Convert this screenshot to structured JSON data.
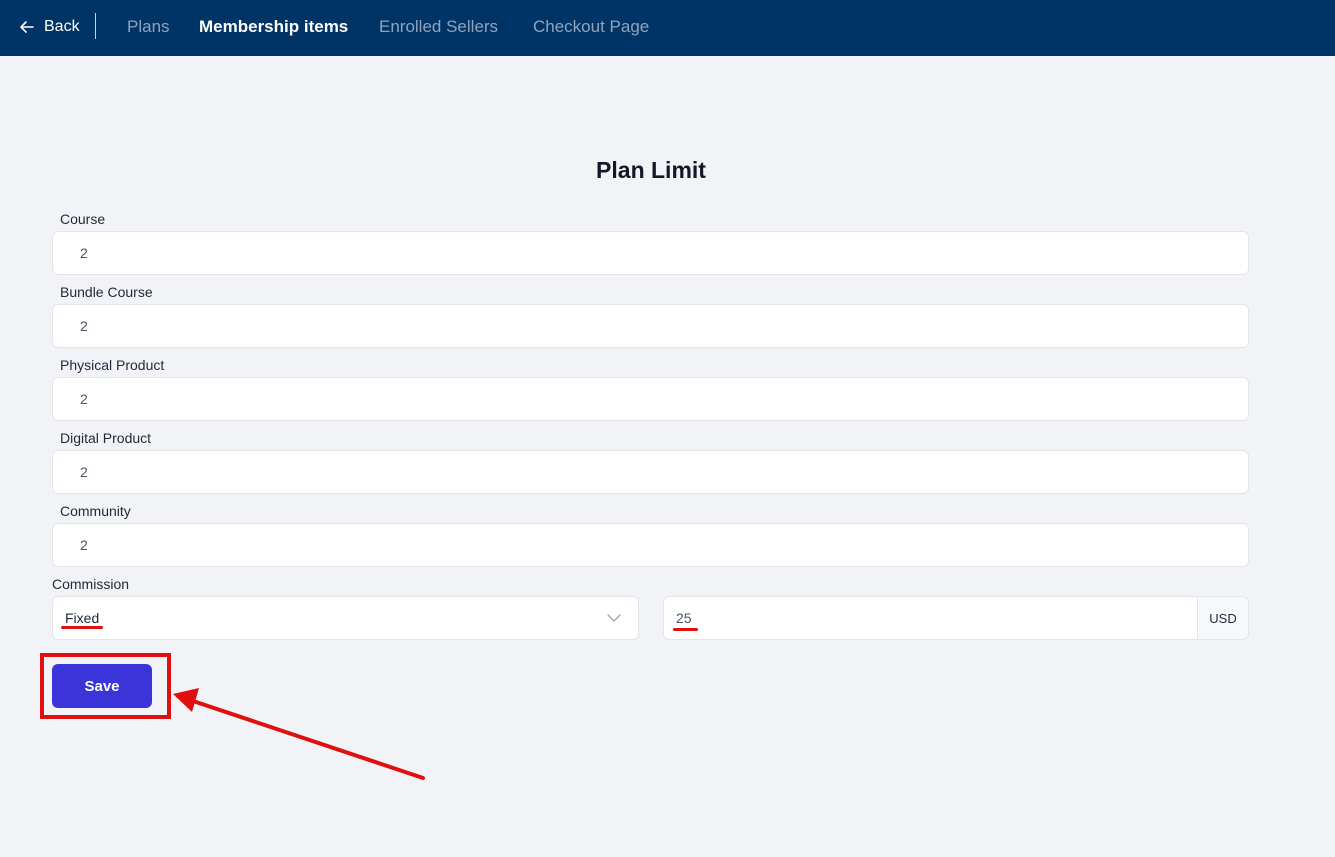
{
  "nav": {
    "back_label": "Back",
    "tabs": [
      {
        "label": "Plans",
        "active": false
      },
      {
        "label": "Membership items",
        "active": true
      },
      {
        "label": "Enrolled Sellers",
        "active": false
      },
      {
        "label": "Checkout Page",
        "active": false
      }
    ]
  },
  "page": {
    "title": "Plan Limit"
  },
  "fields": [
    {
      "label": "Course",
      "value": "2"
    },
    {
      "label": "Bundle Course",
      "value": "2"
    },
    {
      "label": "Physical Product",
      "value": "2"
    },
    {
      "label": "Digital Product",
      "value": "2"
    },
    {
      "label": "Community",
      "value": "2"
    }
  ],
  "commission": {
    "label": "Commission",
    "type_selected": "Fixed",
    "amount": "25",
    "currency": "USD"
  },
  "actions": {
    "save_label": "Save"
  },
  "annotations": {
    "color": "#e01010"
  },
  "colors": {
    "topbar": "#003366",
    "primary_button": "#3b34d9",
    "background": "#f2f3f7"
  }
}
